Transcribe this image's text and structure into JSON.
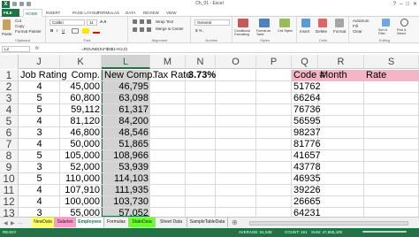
{
  "window": {
    "title": "Ch_01 - Excel",
    "app_logo": "X"
  },
  "ribbon_tabs": [
    "FILE",
    "HOME",
    "INSERT",
    "PAGE LAYOUT",
    "FORMULAS",
    "DATA",
    "REVIEW",
    "VIEW"
  ],
  "ribbon": {
    "clipboard": {
      "paste": "Paste",
      "cut": "Cut",
      "copy": "Copy",
      "format_painter": "Format Painter",
      "label": "Clipboard"
    },
    "font": {
      "name": "Calibri",
      "size": "11",
      "label": "Font"
    },
    "alignment": {
      "wrap": "Wrap Text",
      "merge": "Merge & Center",
      "label": "Alignment"
    },
    "number": {
      "format": "General",
      "label": "Number"
    },
    "styles": {
      "cond": "Conditional Formatting",
      "table": "Format as Table",
      "cell": "Cell Styles",
      "label": "Styles"
    },
    "cells": {
      "insert": "Insert",
      "delete": "Delete",
      "format": "Format",
      "label": "Cells"
    },
    "editing": {
      "autosum": "AutoSum",
      "fill": "Fill",
      "clear": "Clear",
      "sort": "Sort & Filter",
      "find": "Find & Select",
      "label": "Editing"
    }
  },
  "formula_bar": {
    "name_box": "L2",
    "fx": "fx",
    "formula": "=ROUND(K2*$N$1+K2,0)"
  },
  "columns": [
    "J",
    "K",
    "L",
    "M",
    "N",
    "O",
    "P",
    "Q",
    "R",
    "S"
  ],
  "rows": [
    "1",
    "2",
    "3",
    "4",
    "5",
    "6",
    "7",
    "8",
    "9",
    "10",
    "11",
    "12",
    "13"
  ],
  "headers": {
    "j": "Job Rating",
    "k": "Comp.",
    "l": "New Comp.",
    "m": "Tax Rate",
    "n": "3.73%",
    "q": "Code #",
    "r": "Month",
    "s": "Rate"
  },
  "data": {
    "job_rating": [
      "4",
      "5",
      "5",
      "4",
      "3",
      "4",
      "5",
      "3",
      "5",
      "4",
      "4",
      "3"
    ],
    "comp": [
      "45,000",
      "60,800",
      "59,112",
      "81,120",
      "46,800",
      "50,000",
      "105,000",
      "52,000",
      "110,000",
      "107,910",
      "100,000",
      "55,000"
    ],
    "new_comp": [
      "46,795",
      "63,098",
      "61,317",
      "84,200",
      "48,546",
      "51,865",
      "108,966",
      "53,939",
      "114,103",
      "111,935",
      "103,730",
      "57,052"
    ],
    "code": [
      "51762",
      "66264",
      "76736",
      "56595",
      "98237",
      "81776",
      "41657",
      "43778",
      "46935",
      "39226",
      "26665",
      "64231"
    ]
  },
  "sheet_tabs": [
    "NewData",
    "Salaries",
    "Employees",
    "Formulas",
    "StateData",
    "Sheet Data",
    "SampleTableData"
  ],
  "status": {
    "ready": "READY",
    "average": "AVERAGE: 61,548",
    "count": "COUNT: 161",
    "sum": "SUM: 47,865,429"
  },
  "colors": {
    "excel_green": "#217346",
    "pink_header": "#f2b6c6",
    "selection_gray": "#d2d2d2",
    "tab_newdata": "#ffff66",
    "tab_salaries": "#ff99cc",
    "tab_statedata": "#66ff33"
  }
}
